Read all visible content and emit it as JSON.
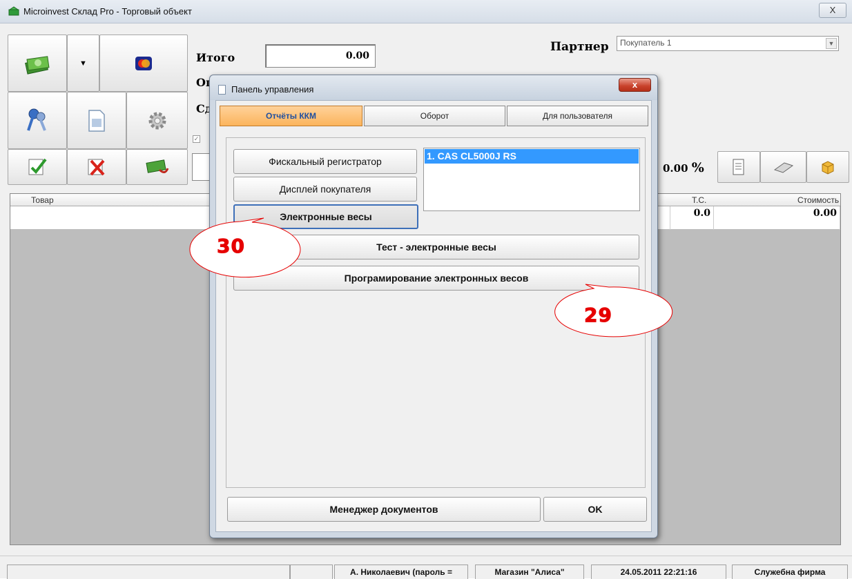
{
  "window": {
    "title": "Microinvest Склад Pro - Торговый объект",
    "close_label": "X"
  },
  "totals": {
    "total_label": "Итого",
    "total_value": "0.00",
    "paid_label": "Оп",
    "change_label": "Сд"
  },
  "partner": {
    "label": "Партнер",
    "value": "Покупатель 1"
  },
  "discount": {
    "value": "0.00",
    "symbol": "%"
  },
  "grid": {
    "columns": [
      "Товар",
      "Т.С.",
      "Стоимость"
    ],
    "row": {
      "ts": "0.0",
      "cost": "0.00"
    }
  },
  "status": {
    "user": "А. Николаевич (пароль =",
    "store": "Магазин \"Алиса\"",
    "datetime": "24.05.2011 22:21:16",
    "company": "Служебна фирма"
  },
  "dialog": {
    "title": "Панель управления",
    "close_label": "x",
    "tabs": [
      "Отчёты ККМ",
      "Оборот",
      "Для пользователя"
    ],
    "device_buttons": [
      "Фискальный регистратор",
      "Дисплей покупателя",
      "Электронные весы"
    ],
    "devices": [
      "1.  CAS CL5000J RS"
    ],
    "action_buttons": [
      "Тест - электронные весы",
      "Програмирование электронных весов"
    ],
    "doc_manager_label": "Менеджер документов",
    "ok_label": "OK"
  },
  "callouts": [
    "30",
    "29"
  ],
  "colors": {
    "active_tab": "#fbb45c",
    "selection": "#3399ff",
    "callout": "#e60000"
  }
}
